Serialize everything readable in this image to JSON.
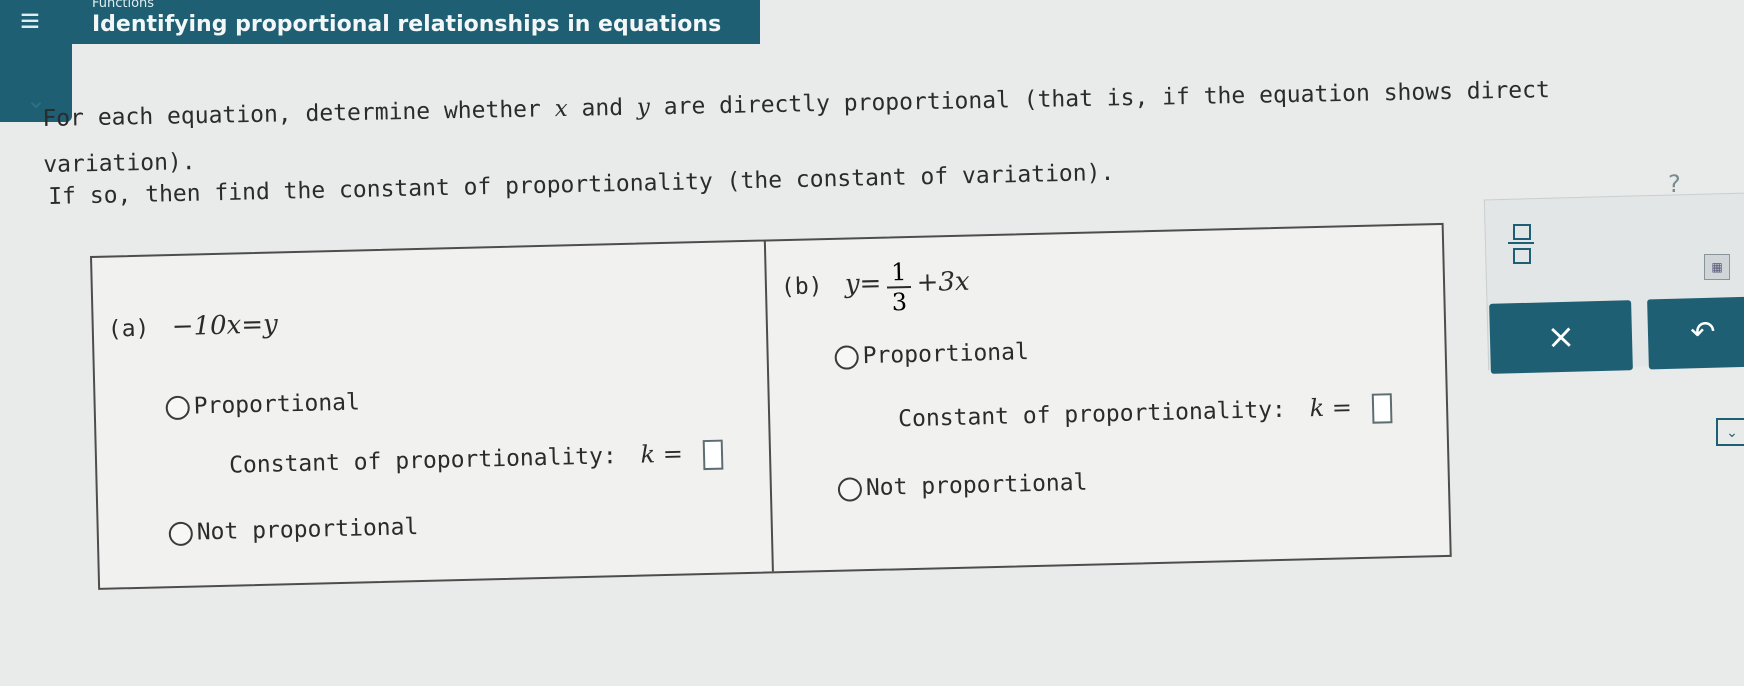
{
  "header": {
    "menu_icon": "hamburger-menu-icon",
    "subject": "Functions",
    "title": "Identifying proportional relationships in equations"
  },
  "collapse_icon": "chevron-down-icon",
  "prompt": {
    "part1": "For each equation, determine whether ",
    "var_x": "x",
    "and": " and ",
    "var_y": "y",
    "part2": " are directly proportional (that is, if the equation shows direct",
    "line2": "variation).",
    "instruction": "If so, then find the constant of proportionality (the constant of variation)."
  },
  "help_icon": "?",
  "part_a": {
    "label": "(a)",
    "equation": "−10x=y",
    "option_proportional": "Proportional",
    "constant_label": "Constant of proportionality:",
    "k_label": "k =",
    "k_value": "",
    "option_not_proportional": "Not proportional"
  },
  "part_b": {
    "label": "(b)",
    "eq_left": "y=",
    "frac_num": "1",
    "frac_den": "3",
    "eq_right": "+3x",
    "option_proportional": "Proportional",
    "constant_label": "Constant of proportionality:",
    "k_label": "k =",
    "k_value": "",
    "option_not_proportional": "Not proportional"
  },
  "tools": {
    "fraction_icon": "fraction-template-icon",
    "clear_label": "×",
    "undo_label": "↶",
    "side_icon": "⌄"
  },
  "colors": {
    "accent": "#1e5f73",
    "background": "#e9eaea",
    "text": "#2b2b2b"
  }
}
